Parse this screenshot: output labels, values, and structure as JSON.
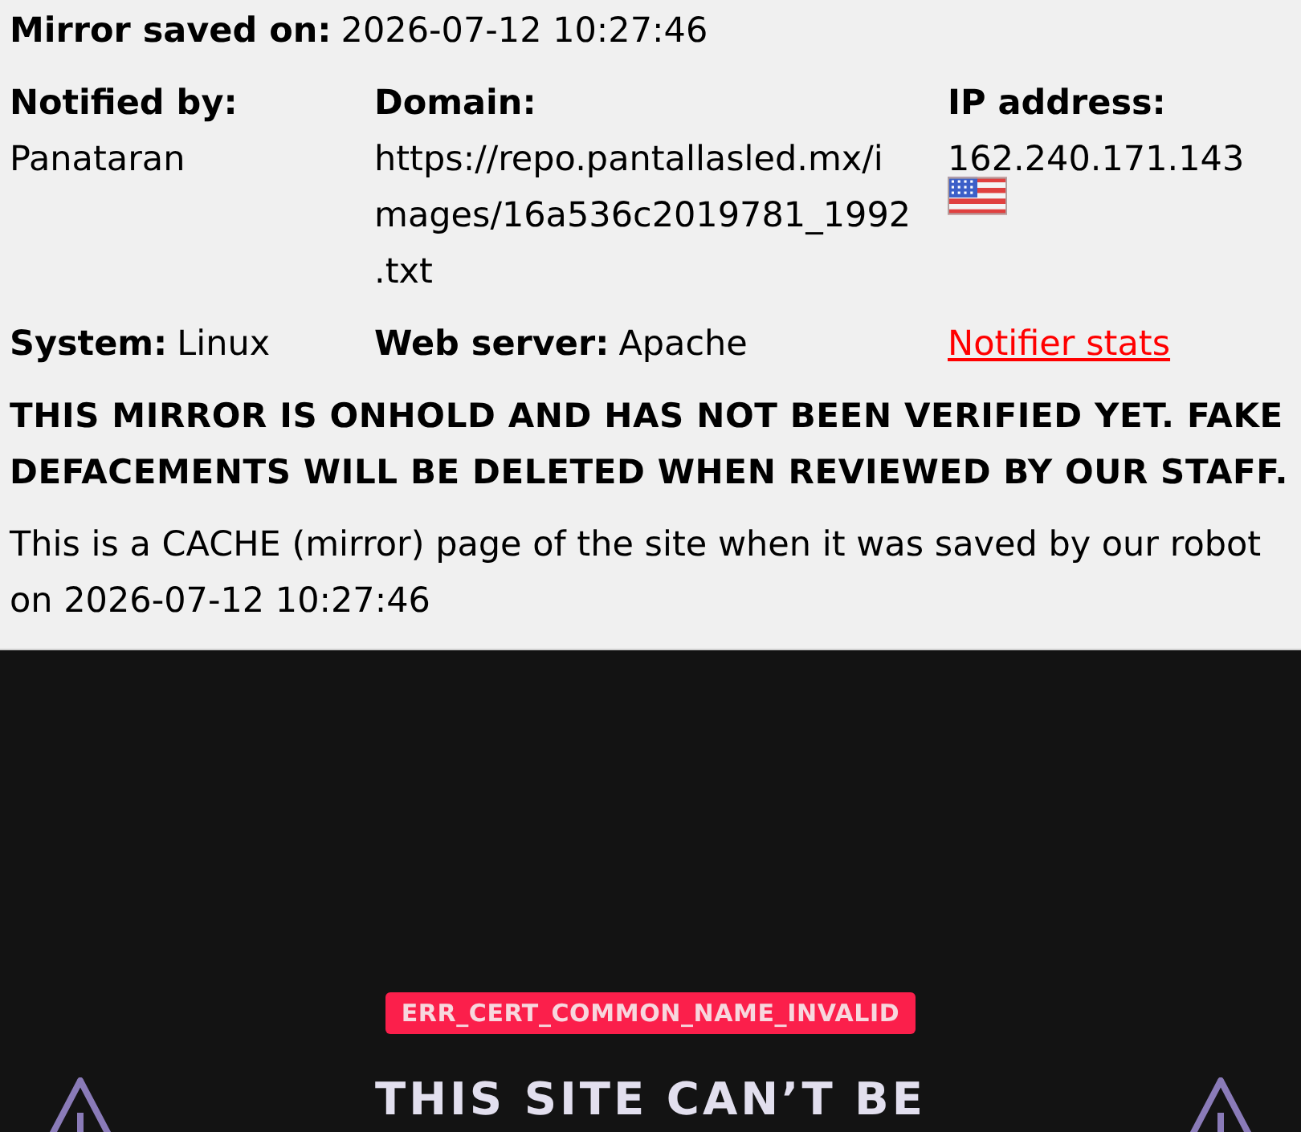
{
  "mirror_saved": {
    "label": "Mirror saved on:",
    "value": "2026-07-12 10:27:46"
  },
  "details": [
    {
      "label": "Notified by:",
      "value": "Panataran"
    },
    {
      "label": "Domain:",
      "value": "https://repo.pantallasled.mx/images/16a536c2019781_1992.txt"
    },
    {
      "label": "IP address:",
      "value": "162.240.171.143"
    }
  ],
  "system": {
    "label": "System:",
    "value": "Linux"
  },
  "web_server": {
    "label": "Web server:",
    "value": "Apache"
  },
  "notifier_stats_link": "Notifier stats",
  "warning": "THIS MIRROR IS ONHOLD AND HAS NOT BEEN VERIFIED YET. FAKE DEFACEMENTS WILL BE DELETED WHEN REVIEWED BY OUR STAFF.",
  "cache_note": "This is a CACHE (mirror) page of the site when it was saved by our robot on 2026-07-12 10:27:46",
  "mirror_page": {
    "error_code": "ERR_CERT_COMMON_NAME_INVALID",
    "heading": "THIS SITE CAN’T BE"
  }
}
